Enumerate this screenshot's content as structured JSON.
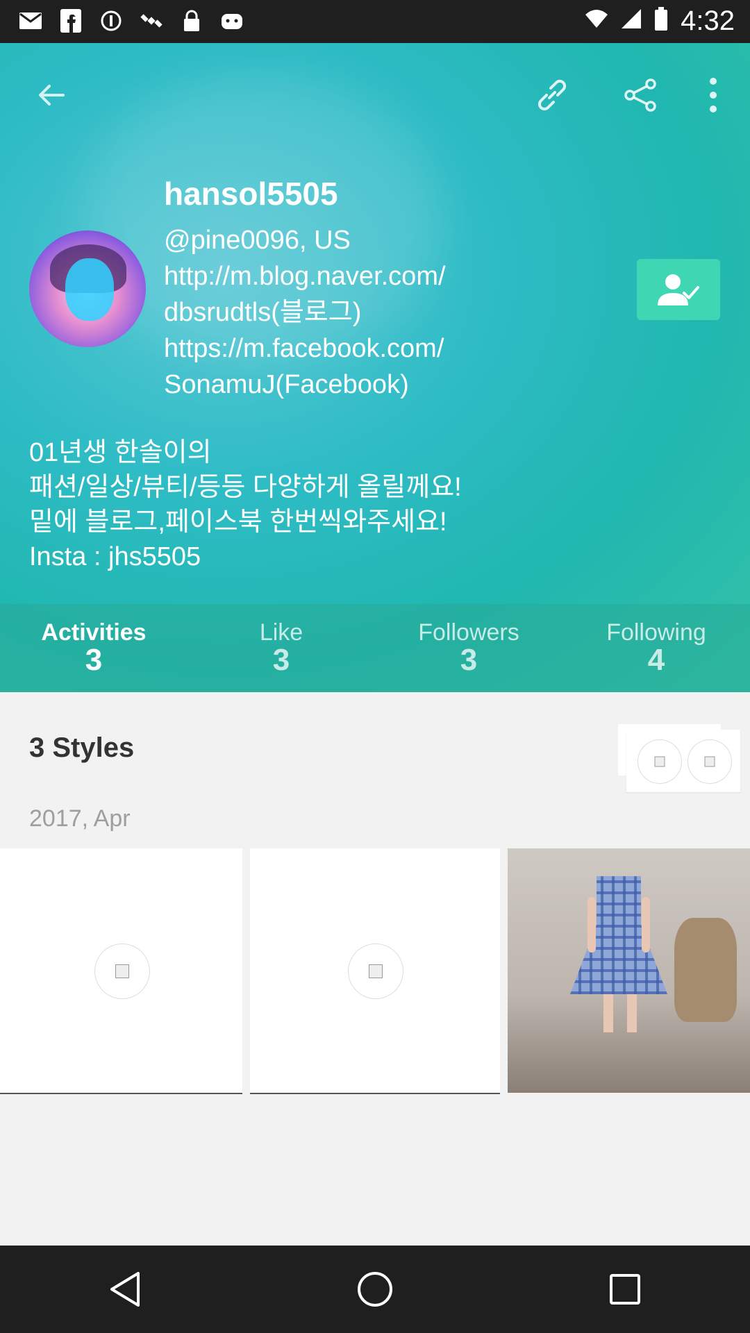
{
  "status_bar": {
    "time": "4:32",
    "left_icons": [
      "mail-icon",
      "facebook-icon",
      "block-icon",
      "satellite-icon",
      "lock-icon",
      "android-icon"
    ],
    "right_icons": [
      "wifi-icon",
      "signal-icon",
      "battery-icon"
    ]
  },
  "header": {
    "username": "hansol5505",
    "bio_lines": [
      "@pine0096, US",
      "http://m.blog.naver.com/",
      "dbsrudtls(블로그)",
      "https://m.facebook.com/",
      "SonamuJ(Facebook)"
    ],
    "description_lines": [
      "01년생 한솔이의",
      "패션/일상/뷰티/등등 다양하게 올릴께요!",
      "밑에 블로그,페이스북 한번씩와주세요!",
      "Insta : jhs5505"
    ],
    "colors": {
      "accent": "#3fd6b4",
      "header": "#2fbcc6"
    }
  },
  "stats": [
    {
      "label": "Activities",
      "count": "3"
    },
    {
      "label": "Like",
      "count": "3"
    },
    {
      "label": "Followers",
      "count": "3"
    },
    {
      "label": "Following",
      "count": "4"
    }
  ],
  "content": {
    "styles_title": "3 Styles",
    "date_label": "2017, Apr"
  }
}
